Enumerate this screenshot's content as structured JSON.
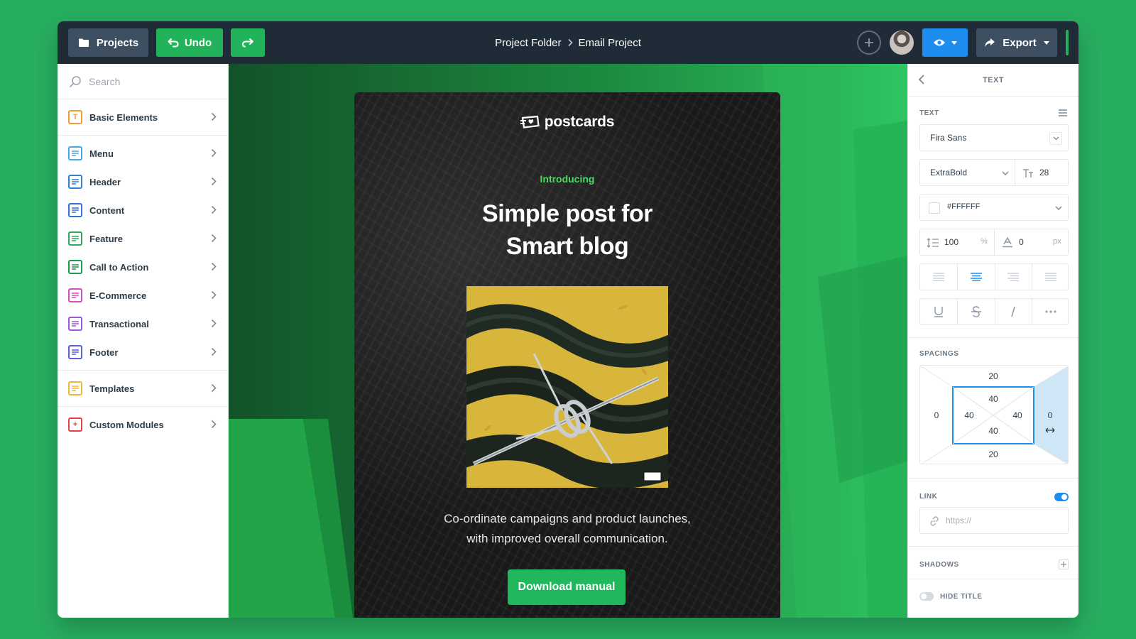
{
  "toolbar": {
    "projects_label": "Projects",
    "undo_label": "Undo",
    "breadcrumb": [
      "Project Folder",
      "Email Project"
    ],
    "export_label": "Export"
  },
  "sidebar": {
    "search_placeholder": "Search",
    "items": [
      {
        "label": "Basic Elements",
        "icon": "text-block-icon",
        "color": "#f39c35",
        "glyph": "T"
      },
      {
        "label": "Menu",
        "icon": "menu-block-icon",
        "color": "#4aa8e8",
        "glyph": ""
      },
      {
        "label": "Header",
        "icon": "header-block-icon",
        "color": "#2f80d6",
        "glyph": ""
      },
      {
        "label": "Content",
        "icon": "content-block-icon",
        "color": "#3b6fd8",
        "glyph": ""
      },
      {
        "label": "Feature",
        "icon": "feature-block-icon",
        "color": "#2eaa5c",
        "glyph": ""
      },
      {
        "label": "Call to Action",
        "icon": "cta-block-icon",
        "color": "#1f9a4b",
        "glyph": ""
      },
      {
        "label": "E-Commerce",
        "icon": "cart-block-icon",
        "color": "#d94bc0",
        "glyph": ""
      },
      {
        "label": "Transactional",
        "icon": "transaction-block-icon",
        "color": "#9b59d9",
        "glyph": ""
      },
      {
        "label": "Footer",
        "icon": "footer-block-icon",
        "color": "#5b5fd8",
        "glyph": ""
      },
      {
        "label": "Templates",
        "icon": "templates-block-icon",
        "color": "#f2b632",
        "glyph": ""
      },
      {
        "label": "Custom Modules",
        "icon": "custom-module-icon",
        "color": "#e8414a",
        "glyph": "+"
      }
    ]
  },
  "email": {
    "logo": "postcards",
    "intro": "Introducing",
    "headline_line1": "Simple post for",
    "headline_line2": "Smart blog",
    "body_line1": "Co-ordinate campaigns and product launches,",
    "body_line2": "with improved overall communication.",
    "cta": "Download manual"
  },
  "panel": {
    "title": "TEXT",
    "text_section": "TEXT",
    "font_family": "Fira Sans",
    "font_weight": "ExtraBold",
    "font_size": "28",
    "color": "#FFFFFF",
    "line_height": "100",
    "line_height_unit": "%",
    "letter_spacing": "0",
    "letter_spacing_unit": "px",
    "spacings_label": "SPACINGS",
    "spacing": {
      "outer_top": "20",
      "outer_bottom": "20",
      "outer_left": "0",
      "outer_right": "0",
      "inner_top": "40",
      "inner_bottom": "40",
      "inner_left": "40",
      "inner_right": "40"
    },
    "link_label": "LINK",
    "link_enabled": true,
    "link_placeholder": "https://",
    "shadows_label": "SHADOWS",
    "hide_title_label": "HIDE TITLE",
    "hide_title_enabled": false
  },
  "colors": {
    "background": "#27ae60",
    "topbar": "#1f2b36",
    "accent_green": "#22b35a",
    "accent_blue": "#1d8ef0"
  }
}
